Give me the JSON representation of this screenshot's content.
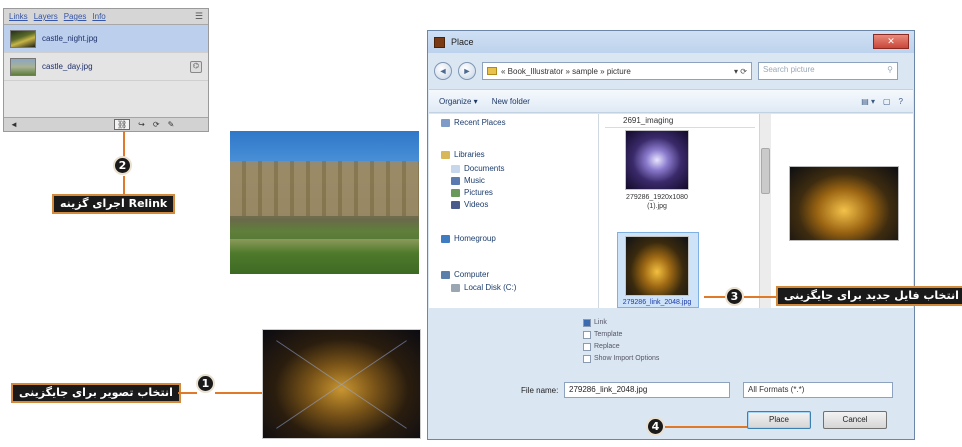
{
  "links_panel": {
    "tabs": [
      "Links",
      "Layers",
      "Pages",
      "Info"
    ],
    "menu_icon": "panel-menu-icon",
    "items": [
      {
        "name": "castle_night.jpg",
        "selected": true
      },
      {
        "name": "castle_day.jpg",
        "selected": false
      }
    ],
    "footer_buttons": [
      "◄",
      "Relink",
      "Goto",
      "Update",
      "Edit"
    ]
  },
  "annotations": {
    "step1_number": "1",
    "step1_label": "انتخاب تصویر برای جایگزینی",
    "step2_number": "2",
    "step2_label": "اجرای گزینه Relink",
    "step3_number": "3",
    "step3_label": "انتخاب فایل جدید برای جایگزینی",
    "step4_number": "4",
    "color_accent": "#e07a2a",
    "color_badge": "#1a1a1a"
  },
  "dialog": {
    "title": "Place",
    "close_label": "✕",
    "address": "« Book_Illustrator » sample » picture",
    "search_placeholder": "Search picture",
    "toolbar": {
      "organize": "Organize ▾",
      "new_folder": "New folder",
      "view_icon": "view-options-icon",
      "help_icon": "help-icon"
    },
    "nav_items": [
      {
        "label": "Recent Places",
        "icon": "recent-places-icon"
      },
      {
        "label": "Libraries",
        "icon": "libraries-icon"
      },
      {
        "label": "Documents",
        "icon": "documents-icon"
      },
      {
        "label": "Music",
        "icon": "music-icon"
      },
      {
        "label": "Pictures",
        "icon": "pictures-icon"
      },
      {
        "label": "Videos",
        "icon": "videos-icon"
      },
      {
        "label": "Homegroup",
        "icon": "homegroup-icon"
      },
      {
        "label": "Computer",
        "icon": "computer-icon"
      },
      {
        "label": "Local Disk (C:)",
        "icon": "local-disk-icon"
      }
    ],
    "file_column_header": "2691_imaging",
    "files": [
      {
        "name": "279286_1920x1080 (1).jpg",
        "selected": false
      },
      {
        "name": "279286_link_2048.jpg",
        "selected": true
      }
    ],
    "options": [
      {
        "label": "Link",
        "checked": true
      },
      {
        "label": "Template",
        "checked": false
      },
      {
        "label": "Replace",
        "checked": false
      },
      {
        "label": "Show Import Options",
        "checked": false
      }
    ],
    "file_name_label": "File name:",
    "file_name_value": "279286_link_2048.jpg",
    "file_type_value": "All Formats (*.*)",
    "place_button": "Place",
    "cancel_button": "Cancel"
  }
}
